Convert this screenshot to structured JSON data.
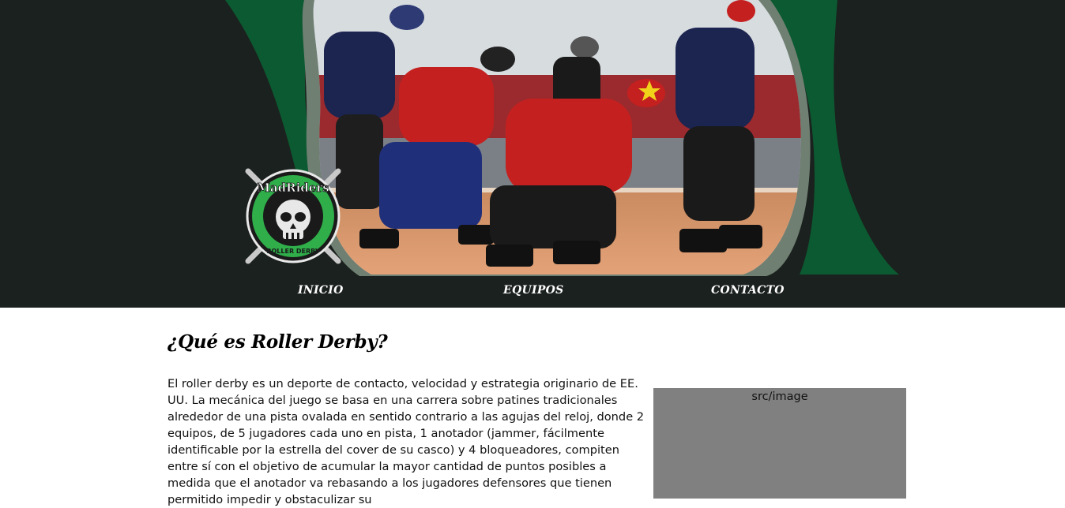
{
  "nav": {
    "items": [
      {
        "label": "INICIO"
      },
      {
        "label": "EQUIPOS"
      },
      {
        "label": "CONTACTO"
      }
    ]
  },
  "logo": {
    "top_text": "MadRiders",
    "bottom_text": "ROLLER DERBY"
  },
  "section": {
    "title": "¿Qué es Roller Derby?",
    "body": "El roller derby es un deporte de contacto, velocidad y estrategia originario de EE. UU. La mecánica del juego se basa en una carrera sobre patines tradicionales alrededor de una pista ovalada en sentido contrario a las agujas del reloj, donde 2 equipos, de 5 jugadores cada uno en pista, 1 anotador (jammer, fácilmente identificable por la estrella del cover de su casco) y 4 bloqueadores, compiten entre sí con el objetivo de acumular la mayor cantidad de puntos posibles a medida que el anotador va rebasando a los jugadores defensores que tienen permitido impedir y obstaculizar su"
  },
  "image_placeholder": {
    "alt": "src/image"
  },
  "colors": {
    "header_bg": "#1b211e",
    "wave_green": "#0c5a31",
    "frame_grey": "#6f7f72",
    "placeholder_grey": "#808080",
    "logo_green": "#2fae4a"
  }
}
